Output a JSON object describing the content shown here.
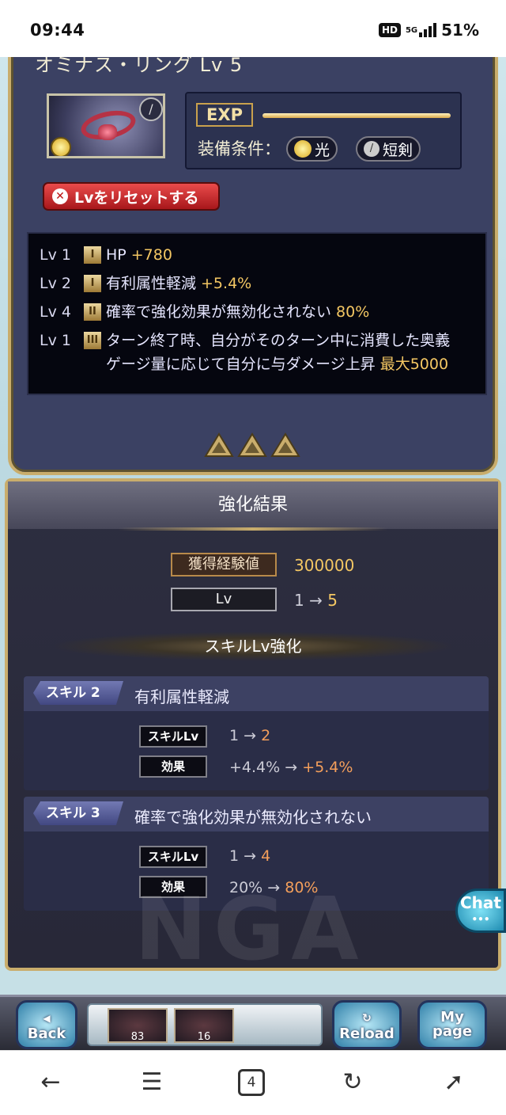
{
  "status_bar": {
    "time": "09:44",
    "net": "5G",
    "battery": "51%",
    "hd": "HD"
  },
  "weapon": {
    "title": "オミナス・リング Lv 5",
    "exp_label": "EXP",
    "equip_label": "装備条件：",
    "equip_element": "光",
    "equip_weapon": "短剣",
    "reset_button": "Lvをリセットする",
    "skills": [
      {
        "lv": "Lv 1",
        "rank": "I",
        "text": "HP",
        "value": "+780"
      },
      {
        "lv": "Lv 2",
        "rank": "I",
        "text": "有利属性軽減",
        "value": "+5.4%"
      },
      {
        "lv": "Lv 4",
        "rank": "II",
        "text": "確率で強化効果が無効化されない",
        "value": "80%"
      },
      {
        "lv": "Lv 1",
        "rank": "III",
        "text": "ターン終了時、自分がそのターン中に消費した奥義ゲージ量に応じて自分に与ダメージ上昇",
        "value": "最大5000"
      }
    ]
  },
  "result": {
    "header": "強化結果",
    "exp_label": "獲得経験値",
    "exp_value": "300000",
    "lv_label": "Lv",
    "lv_from": "1",
    "arrow": "→",
    "lv_to": "5",
    "sub_header": "スキルLv強化",
    "cards": [
      {
        "tag": "スキル 2",
        "name": "有利属性軽減",
        "skill_lv_label": "スキルLv",
        "from": "1",
        "to": "2",
        "effect_label": "効果",
        "eff_from": "+4.4%",
        "eff_to": "+5.4%"
      },
      {
        "tag": "スキル 3",
        "name": "確率で強化効果が無効化されない",
        "skill_lv_label": "スキルLv",
        "from": "1",
        "to": "4",
        "effect_label": "効果",
        "eff_from": "20%",
        "eff_to": "80%"
      }
    ]
  },
  "chat_button": "Chat",
  "watermark": "NGA",
  "game_bar": {
    "back": "Back",
    "reload": "Reload",
    "mypage": "My page",
    "items": [
      "83",
      "16"
    ]
  },
  "browser_nav": {
    "tabs": "4"
  },
  "colors": {
    "accent_gold": "#f4c763",
    "panel": "#3b4163",
    "frame": "#c9ad6c"
  }
}
